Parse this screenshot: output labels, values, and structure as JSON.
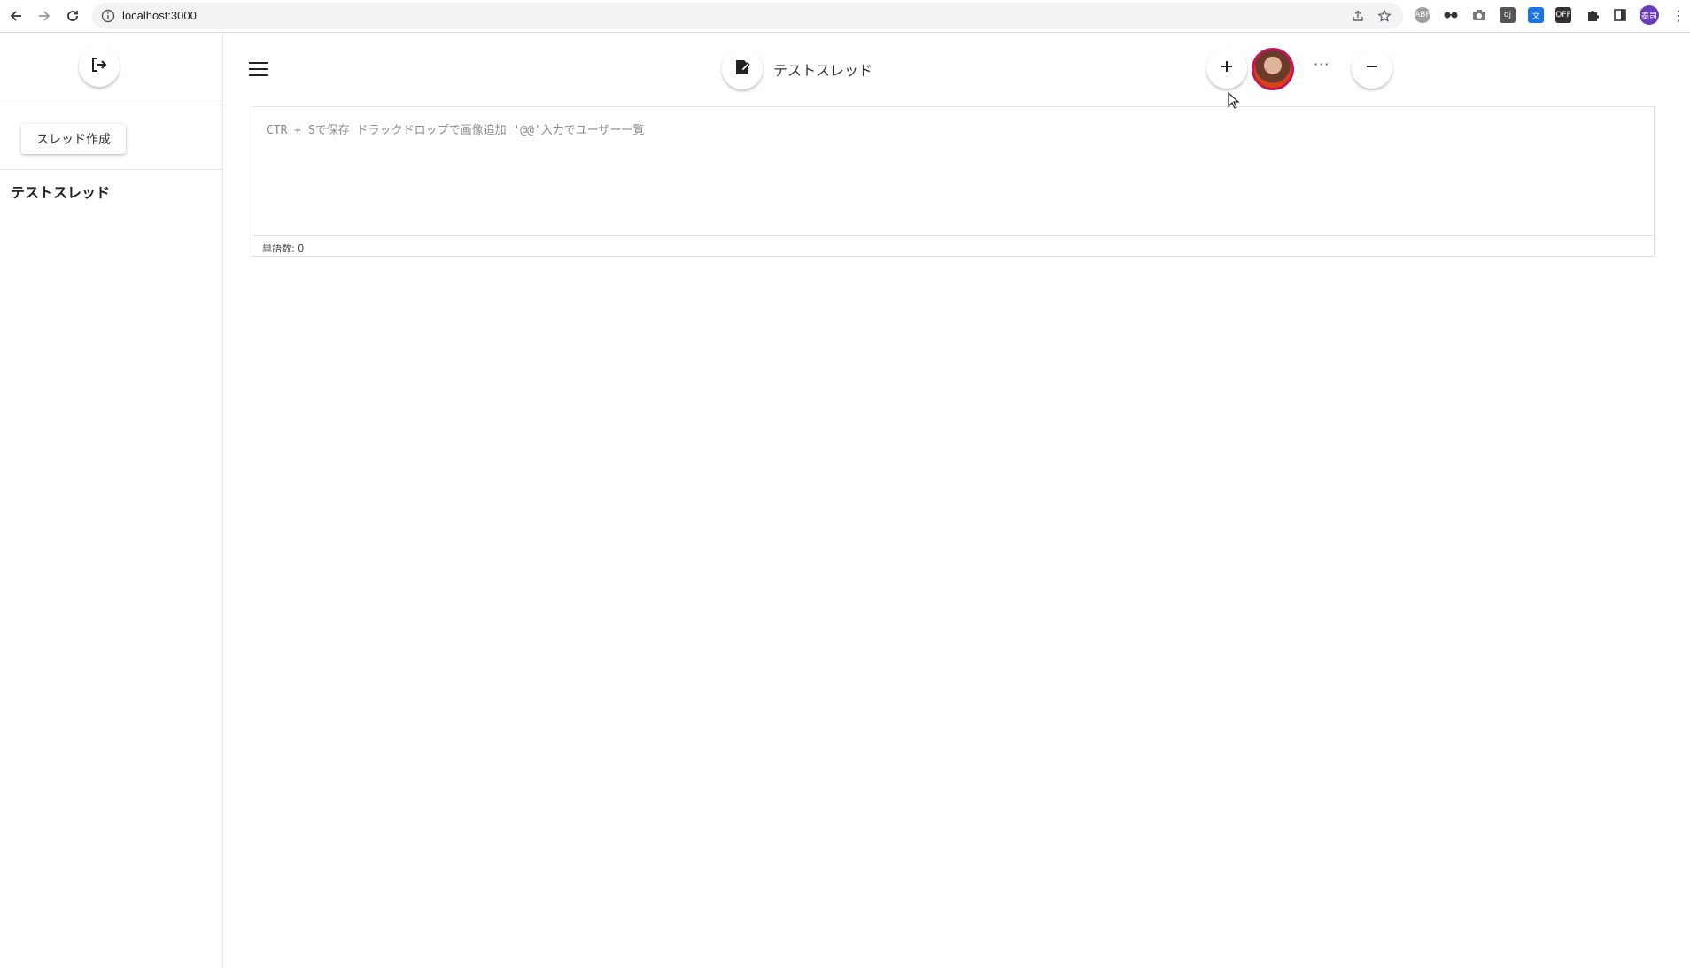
{
  "browser": {
    "url": "localhost:3000",
    "back_icon": "arrow-left-icon",
    "forward_icon": "arrow-right-icon",
    "reload_icon": "reload-icon",
    "profile_initials": "泰司"
  },
  "sidebar": {
    "logout_icon": "logout-icon",
    "create_button_label": "スレッド作成",
    "threads": [
      {
        "label": "テストスレッド"
      }
    ]
  },
  "header": {
    "menu_icon": "hamburger-menu-icon",
    "edit_icon": "edit-icon",
    "title": "テストスレッド",
    "add_icon": "plus-icon",
    "more_label": "···",
    "remove_icon": "minus-icon"
  },
  "editor": {
    "placeholder": "CTR + Sで保存 ドラックドロップで画像追加 '@@'入力でユーザー一覧",
    "word_count_label": "単語数: 0"
  },
  "colors": {
    "avatar_border": "#c2185b",
    "profile_badge": "#6a3cb5"
  }
}
